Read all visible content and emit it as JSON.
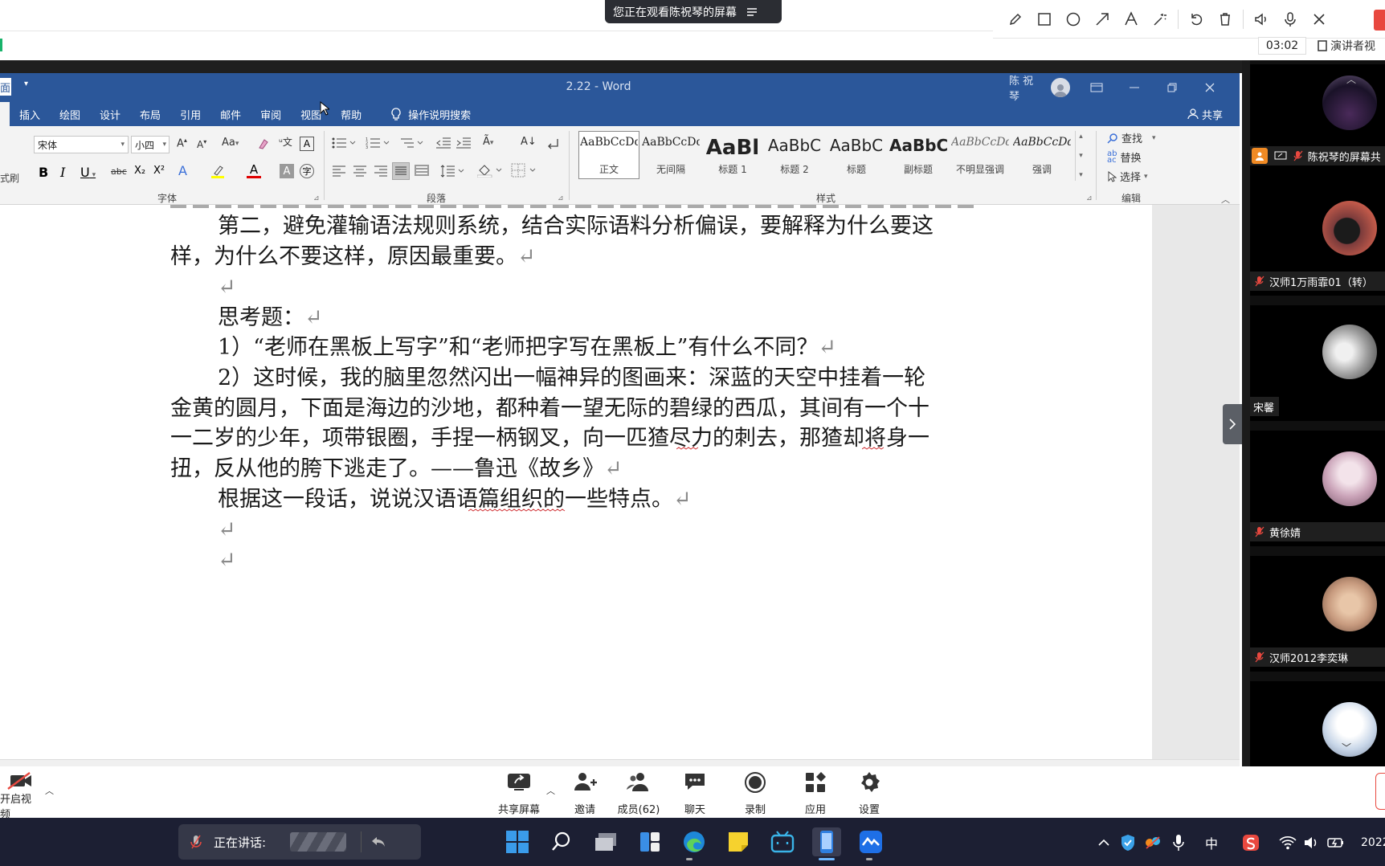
{
  "meeting": {
    "viewing_banner": "您正在观看陈祝琴的屏幕",
    "timer": "03:02",
    "speaker_view_label": "演讲者视",
    "annotation_tools": [
      "pencil-icon",
      "rectangle-icon",
      "circle-icon",
      "arrow-icon",
      "text-icon",
      "magic-wand-icon",
      "undo-icon",
      "trash-icon",
      "speaker-icon",
      "microphone-icon",
      "close-icon"
    ]
  },
  "word": {
    "title": "2.22 - Word",
    "user": "陈 祝琴",
    "left_stub_tab": "面",
    "menu": [
      "插入",
      "绘图",
      "设计",
      "布局",
      "引用",
      "邮件",
      "审阅",
      "视图",
      "帮助"
    ],
    "search_label": "操作说明搜索",
    "share_label": "共享",
    "font": {
      "name": "宋体",
      "size": "小四",
      "group_label": "字体",
      "row2": [
        "B",
        "I",
        "U",
        "abc",
        "X₂",
        "X²"
      ],
      "aa_label": "Aa",
      "pinyin_label": "文"
    },
    "paragraph": {
      "group_label": "段落"
    },
    "styles": {
      "group_label": "样式",
      "items": [
        {
          "preview": "AaBbCcDd",
          "name": "正文"
        },
        {
          "preview": "AaBbCcDd",
          "name": "无间隔"
        },
        {
          "preview": "AaBl",
          "name": "标题 1"
        },
        {
          "preview": "AaBbC",
          "name": "标题 2"
        },
        {
          "preview": "AaBbC",
          "name": "标题"
        },
        {
          "preview": "AaBbC",
          "name": "副标题"
        },
        {
          "preview": "AaBbCcDd",
          "name": "不明显强调"
        },
        {
          "preview": "AaBbCcDd",
          "name": "强调"
        }
      ]
    },
    "editing": {
      "group_label": "编辑",
      "find": "查找",
      "replace": "替换",
      "select": "选择"
    },
    "left_stub_labels": {
      "format_painter": "式刷"
    },
    "document": {
      "para1_l1": "第二，避免灌输语法规则系统，结合实际语料分析偏误，要解释为什么要这",
      "para1_l2": "样，为什么不要这样，原因最重要。",
      "think_title": "思考题：",
      "q1": "1）“老师在黑板上写字”和“老师把字写在黑板上”有什么不同？",
      "q2_l1": "2）这时候，我的脑里忽然闪出一幅神异的图画来：深蓝的天空中挂着一轮",
      "q2_l2": "金黄的圆月，下面是海边的沙地，都种着一望无际的碧绿的西瓜，其间有一个十",
      "q2_l3": "一二岁的少年，项带银圈，手捏一柄钢叉，向一匹猹尽力的刺去，那猹却将身一",
      "q2_l4": "扭，反从他的胯下逃走了。——鲁迅《故乡》",
      "q3": "根据这一段话，说说汉语语篇组织的一些特点。",
      "para_mark": "↵"
    }
  },
  "participants": [
    {
      "name": "陈祝琴的屏幕共享",
      "label": "陈祝琴的屏幕共"
    },
    {
      "name": "汉师1万雨霏01（转）"
    },
    {
      "name": "宋馨"
    },
    {
      "name": "黄徐婧"
    },
    {
      "name": "汉师2012李奕琳"
    },
    {
      "name": ""
    }
  ],
  "toolbar": {
    "video": "开启视频",
    "share": "共享屏幕",
    "invite": "邀请",
    "members": "成员(62)",
    "chat": "聊天",
    "record": "录制",
    "apps": "应用",
    "settings": "设置"
  },
  "taskbar": {
    "speaking_label": "正在讲话:",
    "ime": "中",
    "clock": "2022"
  },
  "colors": {
    "word_blue": "#2b579a",
    "mute_red": "#e8483f",
    "taskbar": "#1c1f33"
  }
}
